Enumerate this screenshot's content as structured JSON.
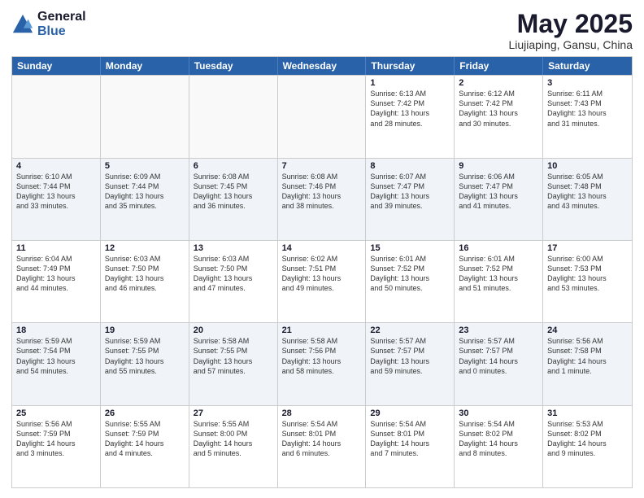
{
  "logo": {
    "general": "General",
    "blue": "Blue"
  },
  "title": "May 2025",
  "location": "Liujiaping, Gansu, China",
  "header_days": [
    "Sunday",
    "Monday",
    "Tuesday",
    "Wednesday",
    "Thursday",
    "Friday",
    "Saturday"
  ],
  "rows": [
    [
      {
        "day": "",
        "info": "",
        "empty": true
      },
      {
        "day": "",
        "info": "",
        "empty": true
      },
      {
        "day": "",
        "info": "",
        "empty": true
      },
      {
        "day": "",
        "info": "",
        "empty": true
      },
      {
        "day": "1",
        "info": "Sunrise: 6:13 AM\nSunset: 7:42 PM\nDaylight: 13 hours\nand 28 minutes.",
        "empty": false
      },
      {
        "day": "2",
        "info": "Sunrise: 6:12 AM\nSunset: 7:42 PM\nDaylight: 13 hours\nand 30 minutes.",
        "empty": false
      },
      {
        "day": "3",
        "info": "Sunrise: 6:11 AM\nSunset: 7:43 PM\nDaylight: 13 hours\nand 31 minutes.",
        "empty": false
      }
    ],
    [
      {
        "day": "4",
        "info": "Sunrise: 6:10 AM\nSunset: 7:44 PM\nDaylight: 13 hours\nand 33 minutes.",
        "empty": false
      },
      {
        "day": "5",
        "info": "Sunrise: 6:09 AM\nSunset: 7:44 PM\nDaylight: 13 hours\nand 35 minutes.",
        "empty": false
      },
      {
        "day": "6",
        "info": "Sunrise: 6:08 AM\nSunset: 7:45 PM\nDaylight: 13 hours\nand 36 minutes.",
        "empty": false
      },
      {
        "day": "7",
        "info": "Sunrise: 6:08 AM\nSunset: 7:46 PM\nDaylight: 13 hours\nand 38 minutes.",
        "empty": false
      },
      {
        "day": "8",
        "info": "Sunrise: 6:07 AM\nSunset: 7:47 PM\nDaylight: 13 hours\nand 39 minutes.",
        "empty": false
      },
      {
        "day": "9",
        "info": "Sunrise: 6:06 AM\nSunset: 7:47 PM\nDaylight: 13 hours\nand 41 minutes.",
        "empty": false
      },
      {
        "day": "10",
        "info": "Sunrise: 6:05 AM\nSunset: 7:48 PM\nDaylight: 13 hours\nand 43 minutes.",
        "empty": false
      }
    ],
    [
      {
        "day": "11",
        "info": "Sunrise: 6:04 AM\nSunset: 7:49 PM\nDaylight: 13 hours\nand 44 minutes.",
        "empty": false
      },
      {
        "day": "12",
        "info": "Sunrise: 6:03 AM\nSunset: 7:50 PM\nDaylight: 13 hours\nand 46 minutes.",
        "empty": false
      },
      {
        "day": "13",
        "info": "Sunrise: 6:03 AM\nSunset: 7:50 PM\nDaylight: 13 hours\nand 47 minutes.",
        "empty": false
      },
      {
        "day": "14",
        "info": "Sunrise: 6:02 AM\nSunset: 7:51 PM\nDaylight: 13 hours\nand 49 minutes.",
        "empty": false
      },
      {
        "day": "15",
        "info": "Sunrise: 6:01 AM\nSunset: 7:52 PM\nDaylight: 13 hours\nand 50 minutes.",
        "empty": false
      },
      {
        "day": "16",
        "info": "Sunrise: 6:01 AM\nSunset: 7:52 PM\nDaylight: 13 hours\nand 51 minutes.",
        "empty": false
      },
      {
        "day": "17",
        "info": "Sunrise: 6:00 AM\nSunset: 7:53 PM\nDaylight: 13 hours\nand 53 minutes.",
        "empty": false
      }
    ],
    [
      {
        "day": "18",
        "info": "Sunrise: 5:59 AM\nSunset: 7:54 PM\nDaylight: 13 hours\nand 54 minutes.",
        "empty": false
      },
      {
        "day": "19",
        "info": "Sunrise: 5:59 AM\nSunset: 7:55 PM\nDaylight: 13 hours\nand 55 minutes.",
        "empty": false
      },
      {
        "day": "20",
        "info": "Sunrise: 5:58 AM\nSunset: 7:55 PM\nDaylight: 13 hours\nand 57 minutes.",
        "empty": false
      },
      {
        "day": "21",
        "info": "Sunrise: 5:58 AM\nSunset: 7:56 PM\nDaylight: 13 hours\nand 58 minutes.",
        "empty": false
      },
      {
        "day": "22",
        "info": "Sunrise: 5:57 AM\nSunset: 7:57 PM\nDaylight: 13 hours\nand 59 minutes.",
        "empty": false
      },
      {
        "day": "23",
        "info": "Sunrise: 5:57 AM\nSunset: 7:57 PM\nDaylight: 14 hours\nand 0 minutes.",
        "empty": false
      },
      {
        "day": "24",
        "info": "Sunrise: 5:56 AM\nSunset: 7:58 PM\nDaylight: 14 hours\nand 1 minute.",
        "empty": false
      }
    ],
    [
      {
        "day": "25",
        "info": "Sunrise: 5:56 AM\nSunset: 7:59 PM\nDaylight: 14 hours\nand 3 minutes.",
        "empty": false
      },
      {
        "day": "26",
        "info": "Sunrise: 5:55 AM\nSunset: 7:59 PM\nDaylight: 14 hours\nand 4 minutes.",
        "empty": false
      },
      {
        "day": "27",
        "info": "Sunrise: 5:55 AM\nSunset: 8:00 PM\nDaylight: 14 hours\nand 5 minutes.",
        "empty": false
      },
      {
        "day": "28",
        "info": "Sunrise: 5:54 AM\nSunset: 8:01 PM\nDaylight: 14 hours\nand 6 minutes.",
        "empty": false
      },
      {
        "day": "29",
        "info": "Sunrise: 5:54 AM\nSunset: 8:01 PM\nDaylight: 14 hours\nand 7 minutes.",
        "empty": false
      },
      {
        "day": "30",
        "info": "Sunrise: 5:54 AM\nSunset: 8:02 PM\nDaylight: 14 hours\nand 8 minutes.",
        "empty": false
      },
      {
        "day": "31",
        "info": "Sunrise: 5:53 AM\nSunset: 8:02 PM\nDaylight: 14 hours\nand 9 minutes.",
        "empty": false
      }
    ]
  ]
}
